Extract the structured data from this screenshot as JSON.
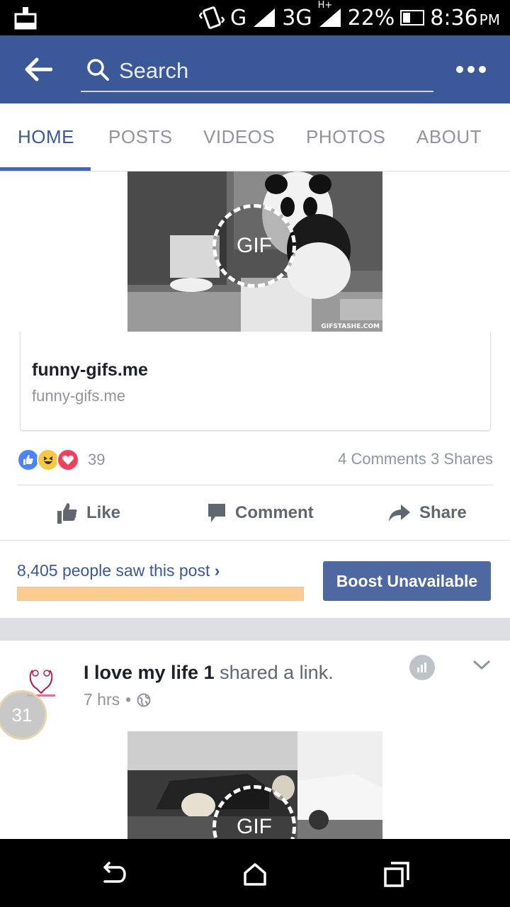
{
  "status_bar": {
    "network_g": "G",
    "network_3g": "3G",
    "network_hplus": "H+",
    "battery": "22%",
    "time": "8:36",
    "ampm": "PM"
  },
  "header": {
    "search_placeholder": "Search",
    "color": "#3b5998"
  },
  "tabs": [
    {
      "label": "HOME",
      "active": true
    },
    {
      "label": "POSTS",
      "active": false
    },
    {
      "label": "VIDEOS",
      "active": false
    },
    {
      "label": "PHOTOS",
      "active": false
    },
    {
      "label": "ABOUT",
      "active": false
    }
  ],
  "post1": {
    "gif_label": "GIF",
    "watermark": "GIFSTASHE.COM",
    "link_title": "funny-gifs.me",
    "link_domain": "funny-gifs.me",
    "reaction_count": "39",
    "comments": "4 Comments",
    "shares": "3 Shares",
    "actions": {
      "like": "Like",
      "comment": "Comment",
      "share": "Share"
    },
    "insights": {
      "text": "8,405 people saw this post",
      "progress_fraction": 1.0
    },
    "boost_label": "Boost Unavailable"
  },
  "post2": {
    "page_name": "I love my life 1",
    "action_text": "shared a link.",
    "time": "7 hrs",
    "gif_label": "GIF",
    "bubble_count": "31"
  },
  "icons": {
    "back": "back-arrow-icon",
    "search": "search-icon",
    "more": "more-icon",
    "like": "thumbs-up-icon",
    "comment": "comment-icon",
    "share": "share-arrow-icon",
    "globe": "globe-icon",
    "nav_back": "nav-back-icon",
    "nav_home": "nav-home-icon",
    "nav_recents": "nav-recents-icon"
  }
}
